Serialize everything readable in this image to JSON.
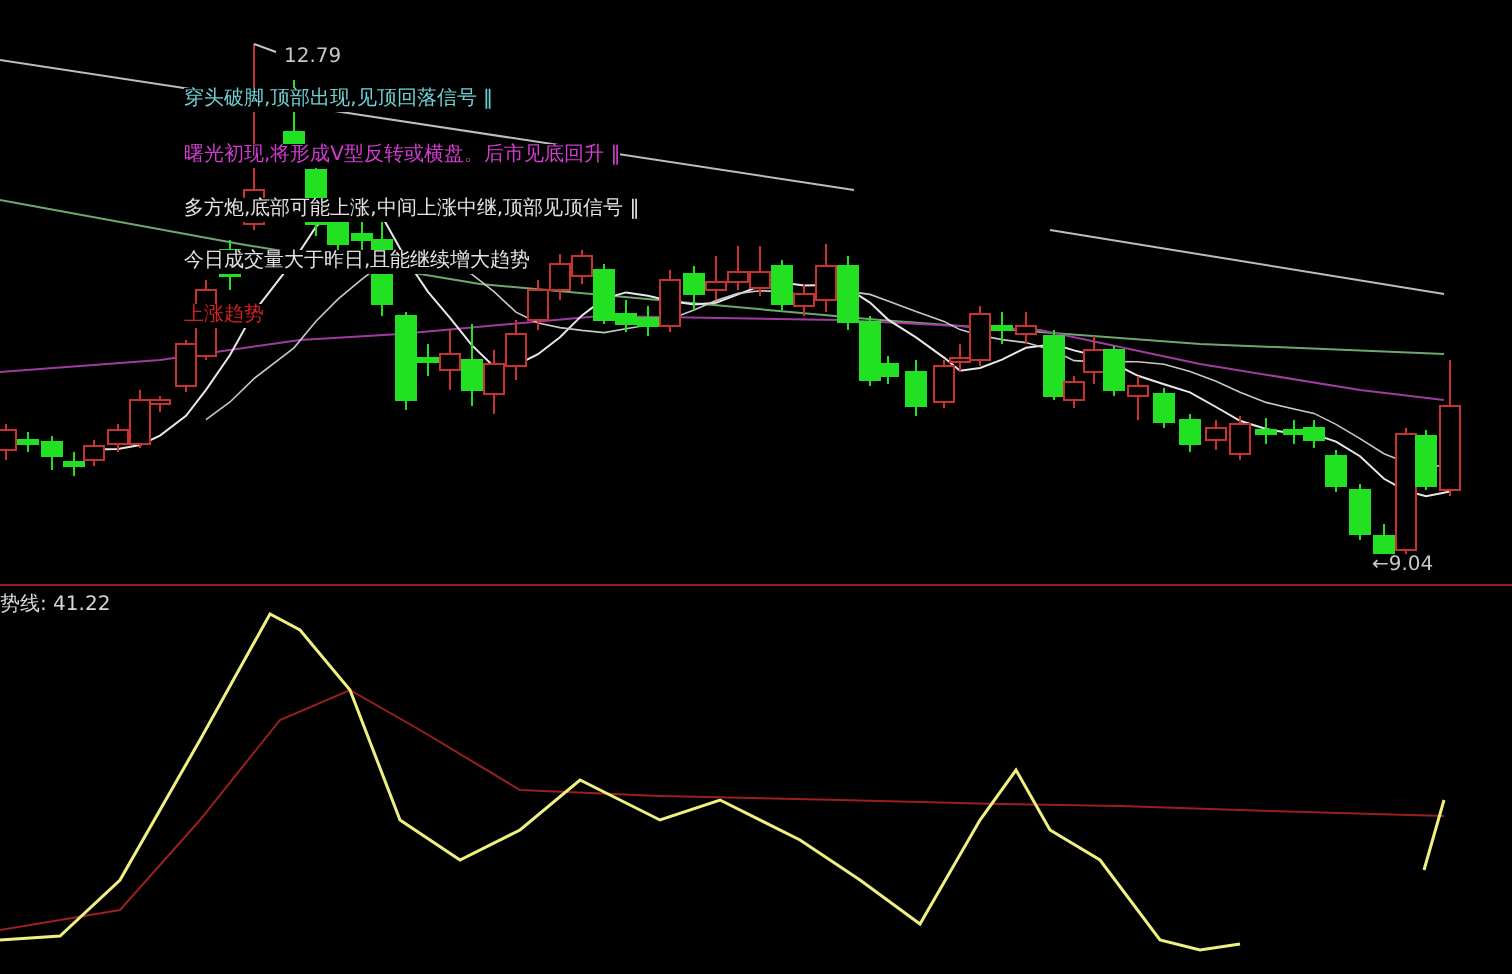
{
  "price_pane": {
    "high_label": "12.79",
    "low_label": "←9.04",
    "signals": [
      {
        "text": "穿头破脚,顶部出现,见顶回落信号 ‖",
        "color": "#6fd3d6"
      },
      {
        "text": "曙光初现,将形成V型反转或横盘。后市见底回升 ‖",
        "color": "#d23cd2"
      },
      {
        "text": "多方炮,底部可能上涨,中间上涨中继,顶部见顶信号 ‖",
        "color": "#e2e2e2"
      },
      {
        "text": "今日成交量大于昨日,且能继续增大趋势",
        "color": "#e2e2e2"
      },
      {
        "text": "上涨趋势",
        "color": "#d42020"
      }
    ]
  },
  "indicator_pane": {
    "label": "势线: 41.22"
  }
}
